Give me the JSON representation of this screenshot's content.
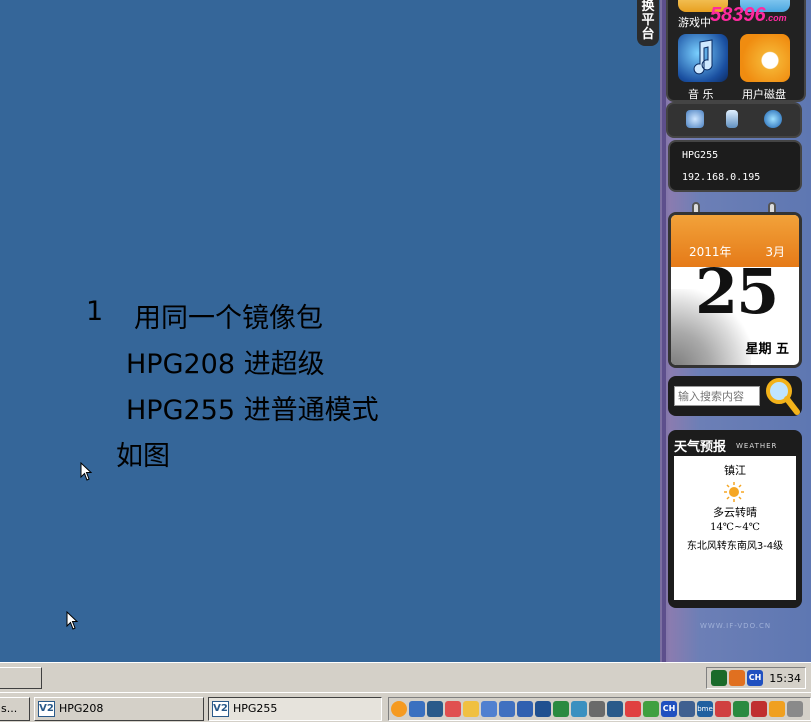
{
  "side_tab": {
    "chars": [
      "换",
      "平",
      "台"
    ]
  },
  "apps": {
    "tile1_label": "游戏中",
    "tile2_label": "音 乐",
    "tile3_label": "用户磁盘",
    "logo_text": "58396",
    "logo_sub": ".com"
  },
  "tools": {
    "icons": [
      "wrench-icon",
      "battery-icon",
      "globe-icon"
    ]
  },
  "network": {
    "host": "HPG255",
    "ip": "192.168.0.195"
  },
  "calendar": {
    "year": "2011年",
    "month": "3月",
    "day": "25",
    "weekday": "星期 五"
  },
  "search": {
    "placeholder": "输入搜索内容"
  },
  "weather": {
    "title": "天气预报",
    "title_en": "WEATHER",
    "city": "镇江",
    "desc": "多云转晴",
    "temp": "14℃~4℃",
    "wind": "东北风转东南风3-4级"
  },
  "rail_footer": "WWW.IF-VDO.CN",
  "notes": {
    "line1_num": "1",
    "line1_text": "用同一个镜像包",
    "line2": "HPG208 进超级",
    "line3": "HPG255 进普通模式",
    "line4": "如图"
  },
  "taskbar_top": {
    "clock": "15:34",
    "tray_badge": "CH"
  },
  "taskbar_bottom": {
    "left_stub": "s...",
    "tasks": [
      {
        "icon": "V2",
        "label": "HPG208"
      },
      {
        "icon": "V2",
        "label": "HPG255"
      }
    ],
    "tray_badges": [
      "CH",
      "bme"
    ]
  }
}
